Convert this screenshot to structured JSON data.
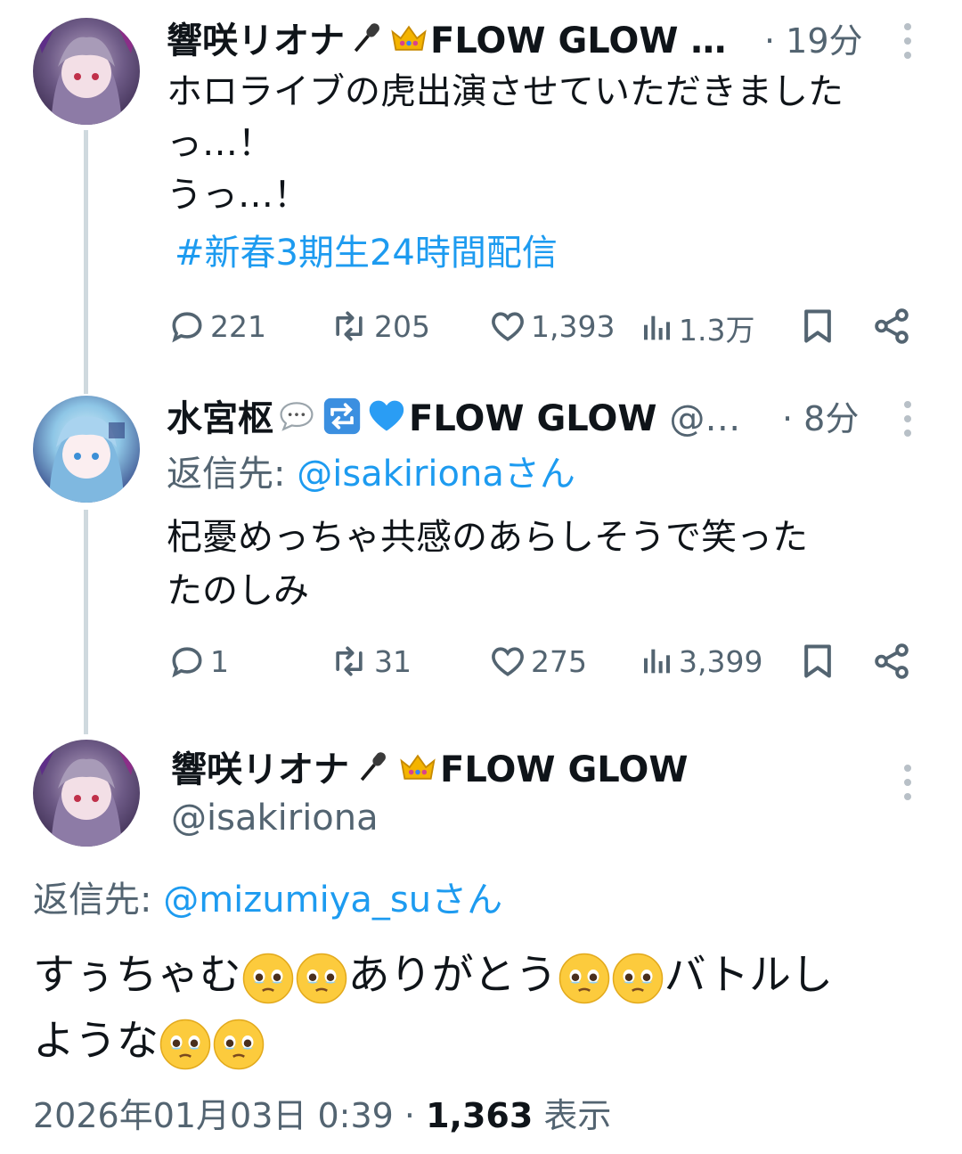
{
  "tweet1": {
    "display_name": "響咲リオナ",
    "name_suffix": "FLOW GLOW …",
    "time": "· 19分",
    "text_lines": [
      "ホロライブの虎出演させていただきましたっ…！",
      "うっ…！"
    ],
    "text_line1": "ホロライブの虎出演させていただきました",
    "text_line2": "っ…！",
    "text_line3": "うっ…！",
    "hashtag": "#新春3期生24時間配信",
    "replies": "221",
    "retweets": "205",
    "likes": "1,393",
    "views": "1.3万"
  },
  "tweet2": {
    "display_name": "水宮枢",
    "name_suffix": "FLOW GLOW",
    "handle": "@…",
    "time": "· 8分",
    "reply_prefix": "返信先: ",
    "reply_to": "@isakirionaさん",
    "text_line1": "杞憂めっちゃ共感のあらしそうで笑った",
    "text_line2": "たのしみ",
    "replies": "1",
    "retweets": "31",
    "likes": "275",
    "views": "3,399"
  },
  "tweet3": {
    "display_name": "響咲リオナ",
    "name_suffix": "FLOW GLOW",
    "handle": "@isakiriona",
    "reply_prefix": "返信先: ",
    "reply_to": "@mizumiya_suさん",
    "text_part1": "すぅちゃむ",
    "text_part2": "ありがとう",
    "text_part3": "バトルし",
    "text_part4": "ような",
    "timestamp": "2026年01月03日 0:39 · ",
    "view_count": "1,363",
    "view_label": " 表示"
  },
  "colors": {
    "link": "#1d9bf0",
    "muted": "#536471",
    "text": "#0f1419",
    "thread_line": "#cfd9de"
  },
  "icons": [
    "microphone-icon",
    "crown-icon",
    "speech-bubble-icon",
    "repeat-icon",
    "blue-heart-icon",
    "reply-icon",
    "retweet-icon",
    "like-icon",
    "views-icon",
    "bookmark-icon",
    "share-icon",
    "more-icon",
    "teary-face-icon"
  ]
}
